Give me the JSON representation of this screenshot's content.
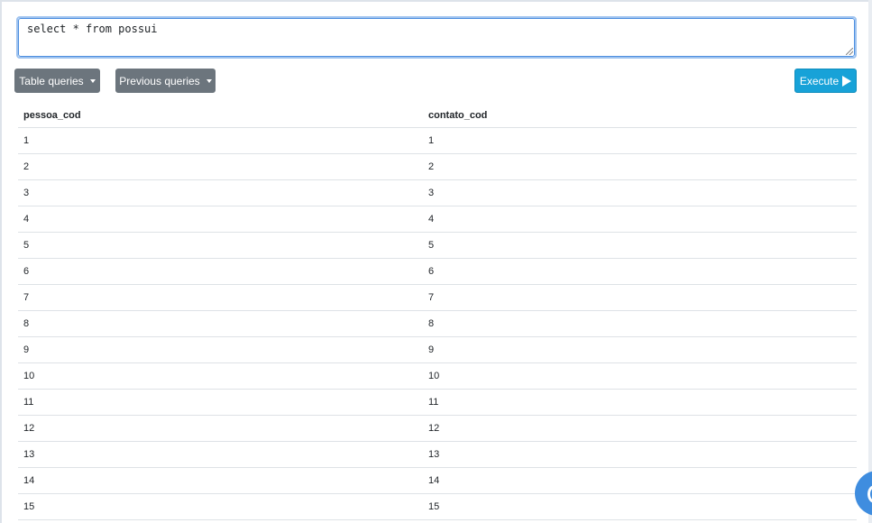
{
  "editor": {
    "query": "select * from possui"
  },
  "toolbar": {
    "table_queries_label": "Table queries",
    "previous_queries_label": "Previous queries",
    "execute_label": "Execute"
  },
  "results": {
    "columns": [
      "pessoa_cod",
      "contato_cod"
    ],
    "rows": [
      [
        "1",
        "1"
      ],
      [
        "2",
        "2"
      ],
      [
        "3",
        "3"
      ],
      [
        "4",
        "4"
      ],
      [
        "5",
        "5"
      ],
      [
        "6",
        "6"
      ],
      [
        "7",
        "7"
      ],
      [
        "8",
        "8"
      ],
      [
        "9",
        "9"
      ],
      [
        "10",
        "10"
      ],
      [
        "11",
        "11"
      ],
      [
        "12",
        "12"
      ],
      [
        "13",
        "13"
      ],
      [
        "14",
        "14"
      ],
      [
        "15",
        "15"
      ]
    ]
  },
  "colors": {
    "execute_bg": "#17a2d8",
    "dropdown_bg": "#6c757d",
    "chat_fab": "#3f8ddf"
  },
  "icons": {
    "execute": "play-icon",
    "dropdown": "caret-down-icon",
    "chat": "chat-bubble-icon"
  }
}
